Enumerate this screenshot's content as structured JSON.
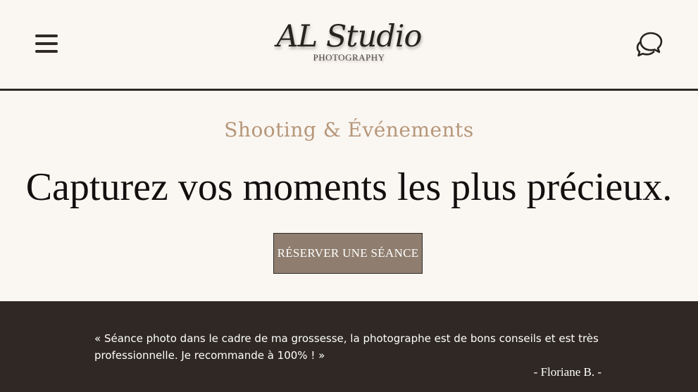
{
  "header": {
    "menu_icon": "hamburger-menu-icon",
    "logo": {
      "name": "AL Studio",
      "subtitle": "PHOTOGRAPHY"
    },
    "chat_icon": "chat-bubbles-icon"
  },
  "hero": {
    "kicker": "Shooting & Événements",
    "title": "Capturez vos moments les plus précieux.",
    "cta_label": "RÉSERVER UNE SÉANCE"
  },
  "testimonial": {
    "quote": "« Séance photo dans le cadre de ma grossesse, la photographe est de bons conseils et est très professionnelle. Je recommande à 100% ! »",
    "author": "- Floriane B. -"
  },
  "colors": {
    "background": "#faf6f2",
    "accent": "#b6977a",
    "button": "#8f7e6f",
    "dark_band": "#2f2824",
    "text_dark": "#12100f"
  }
}
